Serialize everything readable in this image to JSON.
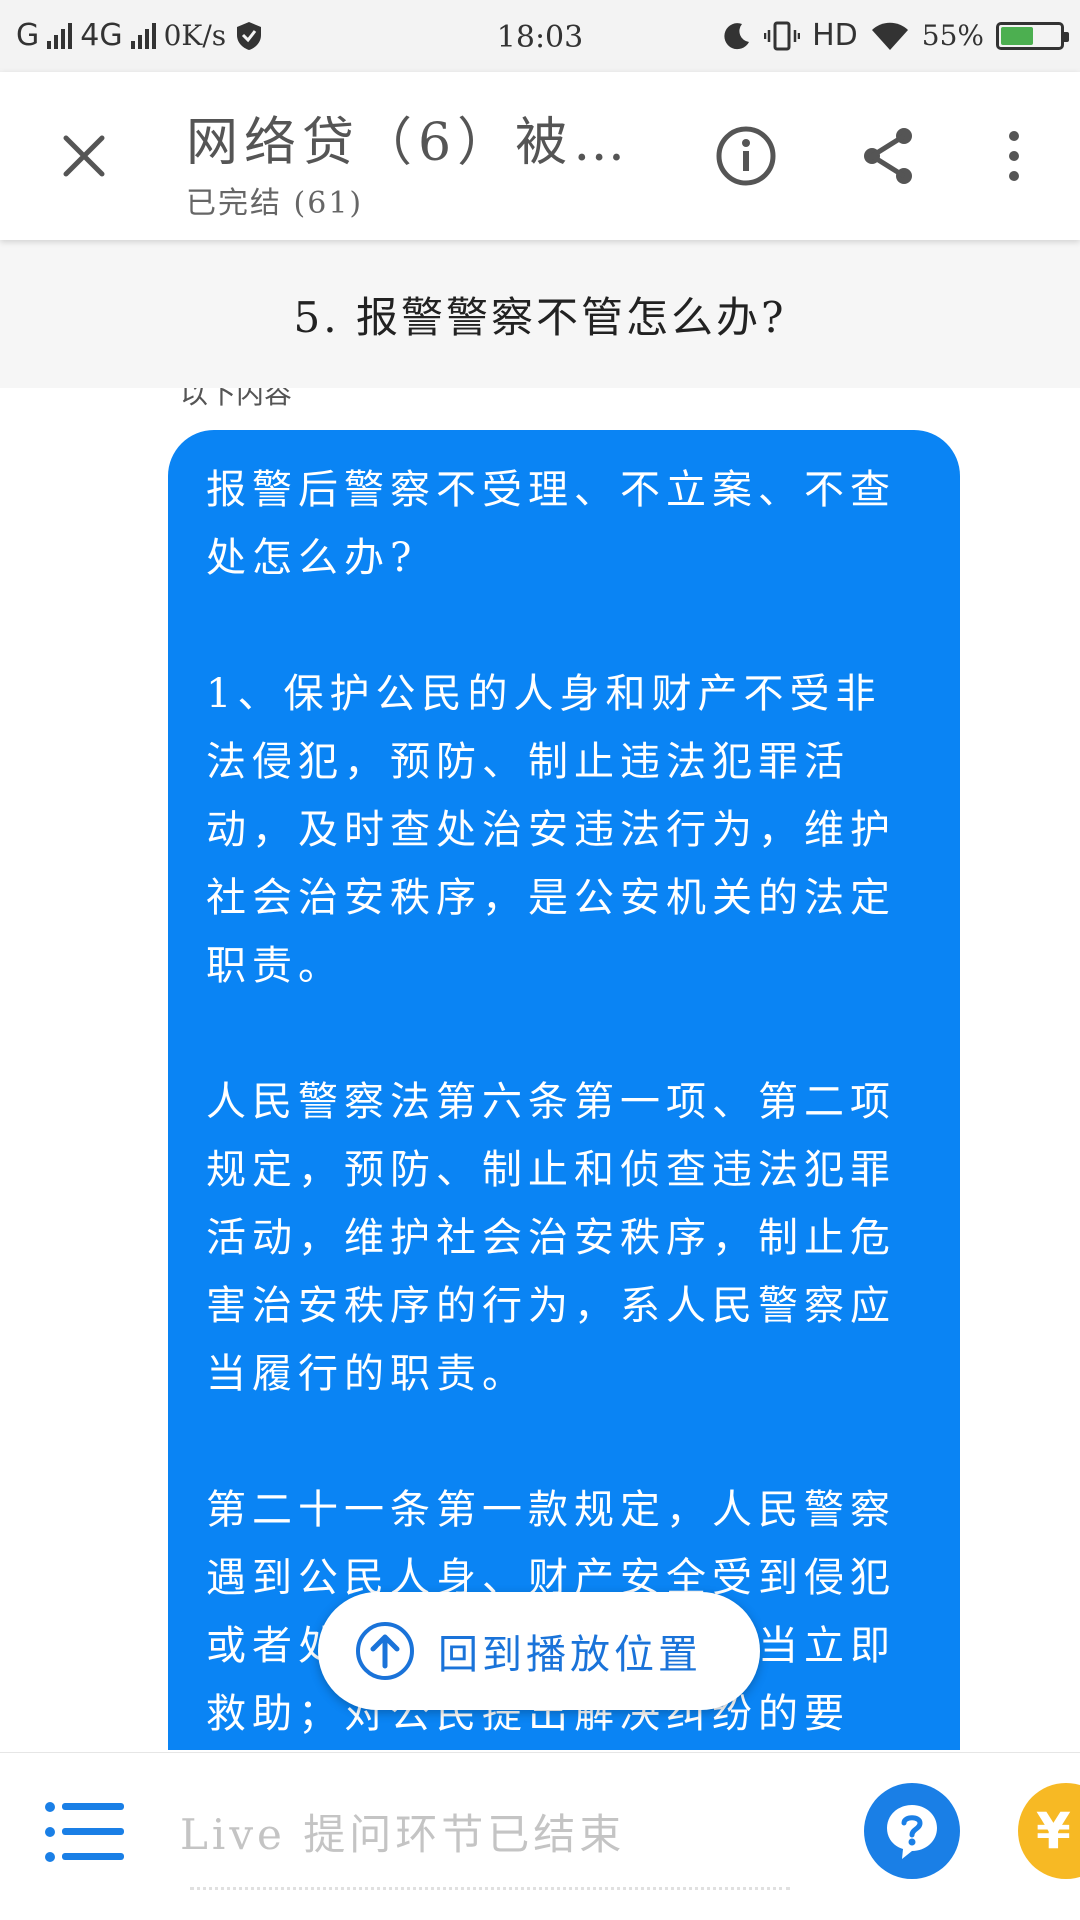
{
  "status_bar": {
    "carrier_1": "G",
    "carrier_2": "4G",
    "speed": "0K/s",
    "time": "18:03",
    "hd": "HD",
    "battery": "55%",
    "battery_level": 0.55
  },
  "app_bar": {
    "title": "网络贷（6）被…",
    "subtitle": "已完结 (61)"
  },
  "section": {
    "heading": "5. 报警警察不管怎么办?",
    "peek_text": "以下内容"
  },
  "message": {
    "paragraphs": [
      "报警后警察不受理、不立案、不查处怎么办?",
      "1、保护公民的人身和财产不受非法侵犯，预防、制止违法犯罪活动，及时查处治安违法行为，维护社会治安秩序，是公安机关的法定职责。",
      "人民警察法第六条第一项、第二项规定，预防、制止和侦查违法犯罪活动，维护社会治安秩序，制止危害治安秩序的行为，系人民警察应当履行的职责。",
      "第二十一条第一款规定，人民警察遇到公民人身、财产安全受到侵犯或者处于其他危难情形，应当立即救助；对公民提出解决纠纷的要"
    ]
  },
  "return_pill": {
    "label": "回到播放位置"
  },
  "bottom_bar": {
    "input_hint": "Live 提问环节已结束",
    "reward_glyph": "¥"
  },
  "colors": {
    "bubble": "#0a84f4",
    "accent": "#1a73d9",
    "reward": "#f7b924"
  }
}
